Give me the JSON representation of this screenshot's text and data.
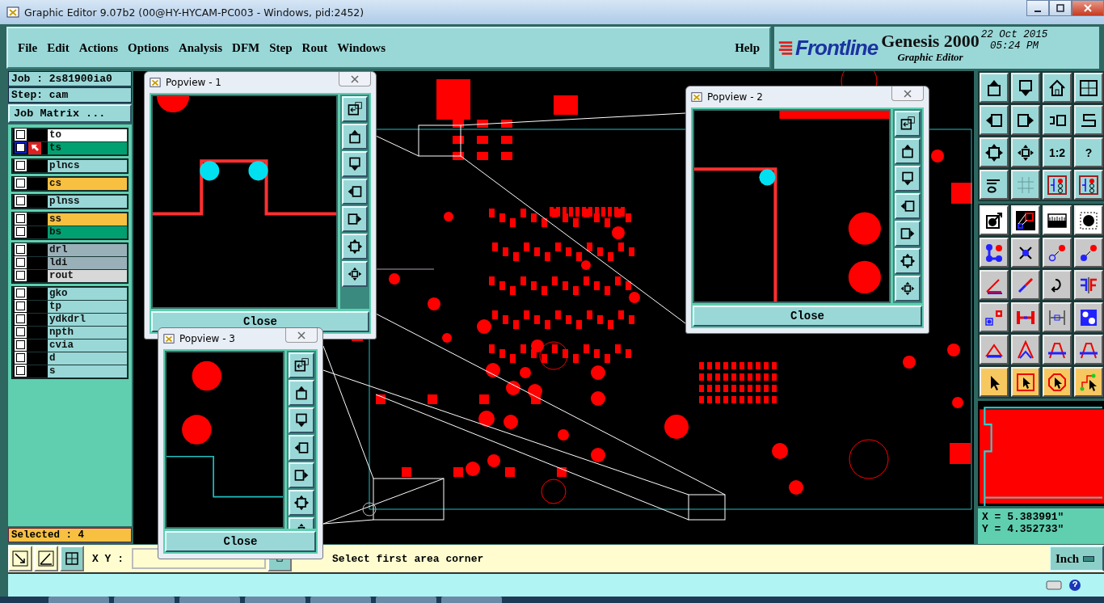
{
  "window": {
    "title": "Graphic Editor 9.07b2 (00@HY-HYCAM-PC003 - Windows, pid:2452)"
  },
  "menu": [
    {
      "label": "File"
    },
    {
      "label": "Edit"
    },
    {
      "label": "Actions"
    },
    {
      "label": "Options"
    },
    {
      "label": "Analysis"
    },
    {
      "label": "DFM"
    },
    {
      "label": "Step"
    },
    {
      "label": "Rout"
    },
    {
      "label": "Windows"
    }
  ],
  "help": "Help",
  "logo": {
    "brand": "Frontline",
    "product": "Genesis 2000",
    "subtitle": "Graphic Editor",
    "date": "22 Oct 2015",
    "time": "05:24 PM"
  },
  "job": {
    "job": "Job : 2s81900ia0",
    "step": "Step: cam",
    "matrix_button": "Job Matrix ..."
  },
  "layer_groups": [
    [
      {
        "name": "to",
        "color": "#ffffff",
        "checked": false,
        "selected": false
      },
      {
        "name": "ts",
        "color": "#00a070",
        "checked": false,
        "selected": true
      }
    ],
    [
      {
        "name": "plncs",
        "color": "#9ad8d8",
        "checked": false,
        "selected": false
      }
    ],
    [
      {
        "name": "cs",
        "color": "#f8c040",
        "checked": false,
        "selected": false
      }
    ],
    [
      {
        "name": "plnss",
        "color": "#9ad8d8",
        "checked": false,
        "selected": false
      }
    ],
    [
      {
        "name": "ss",
        "color": "#f8c040",
        "checked": false,
        "selected": false
      },
      {
        "name": "bs",
        "color": "#00a070",
        "checked": false,
        "selected": false
      }
    ],
    [
      {
        "name": "drl",
        "color": "#9ab0b8",
        "checked": false,
        "selected": false
      },
      {
        "name": "ldi",
        "color": "#9ab0b8",
        "checked": false,
        "selected": false
      },
      {
        "name": "rout",
        "color": "#d8d8d8",
        "checked": false,
        "selected": false
      }
    ],
    [
      {
        "name": "gko",
        "color": "#9ad8d8",
        "checked": false,
        "selected": false
      },
      {
        "name": "tp",
        "color": "#9ad8d8",
        "checked": false,
        "selected": false
      },
      {
        "name": "ydkdrl",
        "color": "#9ad8d8",
        "checked": false,
        "selected": false
      },
      {
        "name": "npth",
        "color": "#9ad8d8",
        "checked": false,
        "selected": false
      },
      {
        "name": "cvia",
        "color": "#9ad8d8",
        "checked": false,
        "selected": false
      },
      {
        "name": "d",
        "color": "#9ad8d8",
        "checked": false,
        "selected": false
      },
      {
        "name": "s",
        "color": "#9ad8d8",
        "checked": false,
        "selected": false
      }
    ]
  ],
  "selected_count": "Selected : 4",
  "view_tools": [
    {
      "kind": "box-up"
    },
    {
      "kind": "box-down"
    },
    {
      "kind": "house"
    },
    {
      "kind": "grid-xy"
    },
    {
      "kind": "box-left"
    },
    {
      "kind": "box-right"
    },
    {
      "kind": "undo-box"
    },
    {
      "kind": "s-curve"
    },
    {
      "kind": "expand"
    },
    {
      "kind": "compass"
    },
    {
      "kind": "label",
      "label": "1:2"
    },
    {
      "kind": "label",
      "label": "?"
    },
    {
      "kind": "wrench"
    },
    {
      "kind": "grid"
    },
    {
      "kind": "traffic"
    },
    {
      "kind": "traffic"
    }
  ],
  "edit_tools": [
    {
      "kind": "ball-arrow",
      "color": "#ffffff"
    },
    {
      "kind": "line-boxes",
      "color": "#ffffff"
    },
    {
      "kind": "ruler",
      "color": "#ffffff"
    },
    {
      "kind": "dot-square",
      "color": "#ffffff"
    },
    {
      "kind": "blue-dots",
      "color": "#c8c8c8"
    },
    {
      "kind": "x-mark",
      "color": "#c8c8c8"
    },
    {
      "kind": "ring-dot",
      "color": "#c8c8c8"
    },
    {
      "kind": "dot-dot",
      "color": "#c8c8c8"
    },
    {
      "kind": "angle",
      "color": "#c8c8c8"
    },
    {
      "kind": "slash",
      "color": "#c8c8c8"
    },
    {
      "kind": "hook",
      "color": "#c8c8c8"
    },
    {
      "kind": "mirror",
      "color": "#c8c8c8"
    },
    {
      "kind": "square-dots",
      "color": "#c8c8c8"
    },
    {
      "kind": "dash",
      "color": "#c8c8c8"
    },
    {
      "kind": "width",
      "color": "#c8c8c8"
    },
    {
      "kind": "blue-squares",
      "color": "#c8c8c8"
    },
    {
      "kind": "triangle",
      "color": "#c8c8c8"
    },
    {
      "kind": "chevron",
      "color": "#c8c8c8"
    },
    {
      "kind": "arch",
      "color": "#c8c8c8"
    },
    {
      "kind": "arch",
      "color": "#c8c8c8"
    },
    {
      "kind": "pointer",
      "color": "#f8c860"
    },
    {
      "kind": "pointer-box",
      "color": "#f8c860"
    },
    {
      "kind": "pointer-oct",
      "color": "#f8c860"
    },
    {
      "kind": "pointer-path",
      "color": "#f8c860"
    }
  ],
  "popviews": [
    {
      "title": "Popview - 1",
      "close": "Close",
      "kind": "corner-notch"
    },
    {
      "title": "Popview - 2",
      "close": "Close",
      "kind": "corner-pads"
    },
    {
      "title": "Popview - 3",
      "close": "Close",
      "kind": "step-pads"
    }
  ],
  "coordinates": {
    "x": "X = 5.383991\"",
    "y": "Y = 4.352733\""
  },
  "units": "Inch",
  "bottom": {
    "xy_label": "X Y :",
    "prompt": "Select first area corner"
  }
}
